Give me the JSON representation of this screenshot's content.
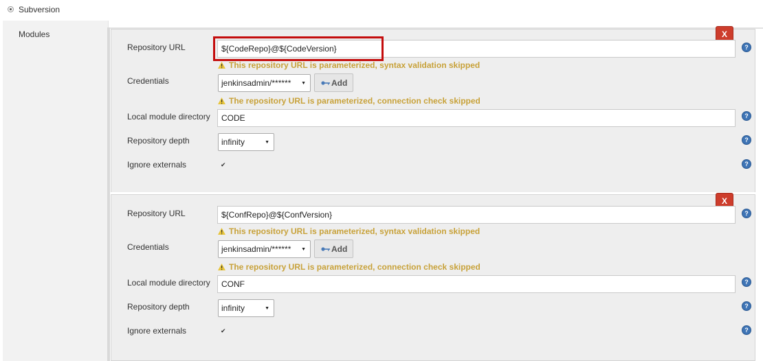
{
  "scm": {
    "option_label": "Subversion"
  },
  "modules_label": "Modules",
  "modules": [
    {
      "repository_url_label": "Repository URL",
      "repository_url_value": "${CodeRepo}@${CodeVersion}",
      "url_warning": "This repository URL is parameterized, syntax validation skipped",
      "credentials_label": "Credentials",
      "credentials_value": "jenkinsadmin/******",
      "add_label": "Add",
      "connection_warning": "The repository URL is parameterized, connection check skipped",
      "local_dir_label": "Local module directory",
      "local_dir_value": "CODE",
      "depth_label": "Repository depth",
      "depth_value": "infinity",
      "ignore_externals_label": "Ignore externals",
      "ignore_externals_checked": true,
      "delete_label": "X"
    },
    {
      "repository_url_label": "Repository URL",
      "repository_url_value": "${ConfRepo}@${ConfVersion}",
      "url_warning": "This repository URL is parameterized, syntax validation skipped",
      "credentials_label": "Credentials",
      "credentials_value": "jenkinsadmin/******",
      "add_label": "Add",
      "connection_warning": "The repository URL is parameterized, connection check skipped",
      "local_dir_label": "Local module directory",
      "local_dir_value": "CONF",
      "depth_label": "Repository depth",
      "depth_value": "infinity",
      "ignore_externals_label": "Ignore externals",
      "ignore_externals_checked": true,
      "delete_label": "X"
    }
  ],
  "help_glyph": "?",
  "checkbox_glyph": "✔",
  "colors": {
    "warning_text": "#c8a23a",
    "delete_button": "#cd3d2c",
    "highlight_border": "#c40d0d",
    "help_icon": "#3e74b5"
  }
}
